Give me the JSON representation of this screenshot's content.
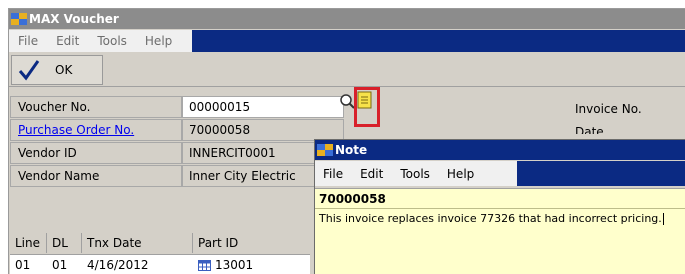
{
  "main_window": {
    "title": "MAX Voucher",
    "menu": [
      "File",
      "Edit",
      "Tools",
      "Help"
    ],
    "toolbar": {
      "ok_label": "OK"
    }
  },
  "form": {
    "voucher_no_label": "Voucher No.",
    "voucher_no_value": "00000015",
    "purchase_order_label": "Purchase Order No.",
    "purchase_order_value": "70000058",
    "vendor_id_label": "Vendor ID",
    "vendor_id_value": "INNERCIT0001",
    "vendor_name_label": "Vendor Name",
    "vendor_name_value": "Inner City Electric",
    "invoice_no_label": "Invoice No.",
    "date_label": "Date"
  },
  "grid": {
    "headers": [
      "Line",
      "DL",
      "Tnx Date",
      "Part ID"
    ],
    "row": [
      "01",
      "01",
      "4/16/2012",
      "13001"
    ]
  },
  "note_window": {
    "title": "Note",
    "menu": [
      "File",
      "Edit",
      "Tools",
      "Help"
    ],
    "note_title": "70000058",
    "note_text": "This invoice replaces invoice 77326 that had incorrect pricing."
  },
  "colors": {
    "menu_accent": "#0b2a83",
    "note_background": "#ffffcc",
    "highlight": "#d8202a"
  }
}
